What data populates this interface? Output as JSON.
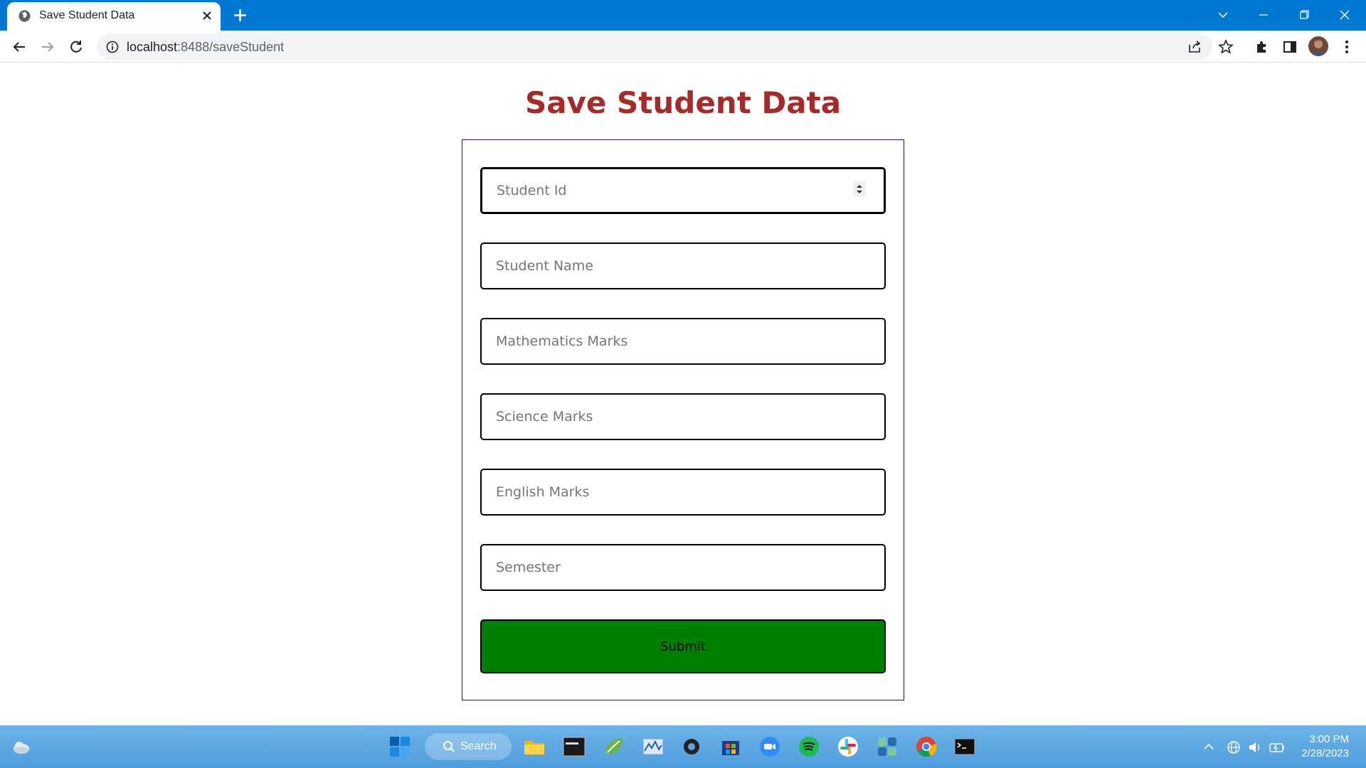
{
  "browser": {
    "tab_title": "Save Student Data",
    "url_host": "localhost",
    "url_rest": ":8488/saveStudent"
  },
  "page": {
    "title": "Save Student Data",
    "fields": {
      "student_id_placeholder": "Student Id",
      "student_name_placeholder": "Student Name",
      "math_placeholder": "Mathematics Marks",
      "science_placeholder": "Science Marks",
      "english_placeholder": "English Marks",
      "semester_placeholder": "Semester"
    },
    "submit_label": "Submit",
    "title_color": "#a52a2a",
    "submit_color": "#008000"
  },
  "taskbar": {
    "search_label": "Search",
    "time": "3:00 PM",
    "date": "2/28/2023"
  }
}
